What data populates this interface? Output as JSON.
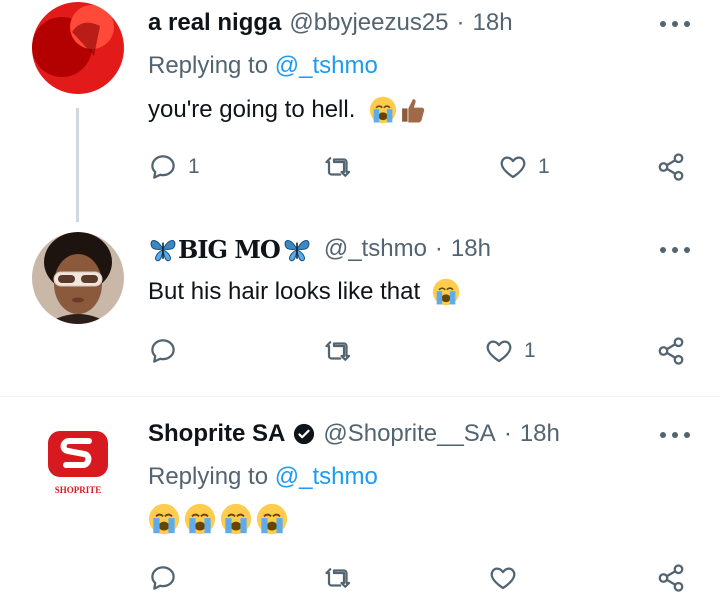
{
  "tweets": [
    {
      "name": "a real nigga",
      "handle": "@bbyjeezus25",
      "sep": "·",
      "time": "18h",
      "replying_prefix": "Replying to ",
      "replying_to": "@_tshmo",
      "text": "you're going to hell.",
      "emojis": [
        "crying-face",
        "thumbs-up"
      ],
      "replies": "1",
      "retweets": "",
      "likes": "1"
    },
    {
      "name": "BIG MO",
      "name_decor": "butterfly",
      "handle": "@_tshmo",
      "sep": "·",
      "time": "18h",
      "text": "But his hair looks like that",
      "emojis": [
        "crying-face"
      ],
      "replies": "",
      "retweets": "",
      "likes": "1"
    },
    {
      "name": "Shoprite SA",
      "handle": "@Shoprite__SA",
      "sep": "·",
      "time": "18h",
      "replying_prefix": "Replying to ",
      "replying_to": "@_tshmo",
      "text": "",
      "emojis": [
        "crying-face",
        "crying-face",
        "crying-face",
        "crying-face"
      ],
      "avatar_logo_text": "SHOPRITE",
      "replies": "",
      "retweets": "",
      "likes": ""
    }
  ],
  "colors": {
    "text": "#0f1419",
    "secondary": "#536471",
    "link": "#1d9bf0",
    "shoprite_red": "#d71920"
  },
  "icons": [
    "reply-icon",
    "retweet-icon",
    "like-icon",
    "share-icon",
    "more-icon",
    "verified-badge-icon"
  ]
}
